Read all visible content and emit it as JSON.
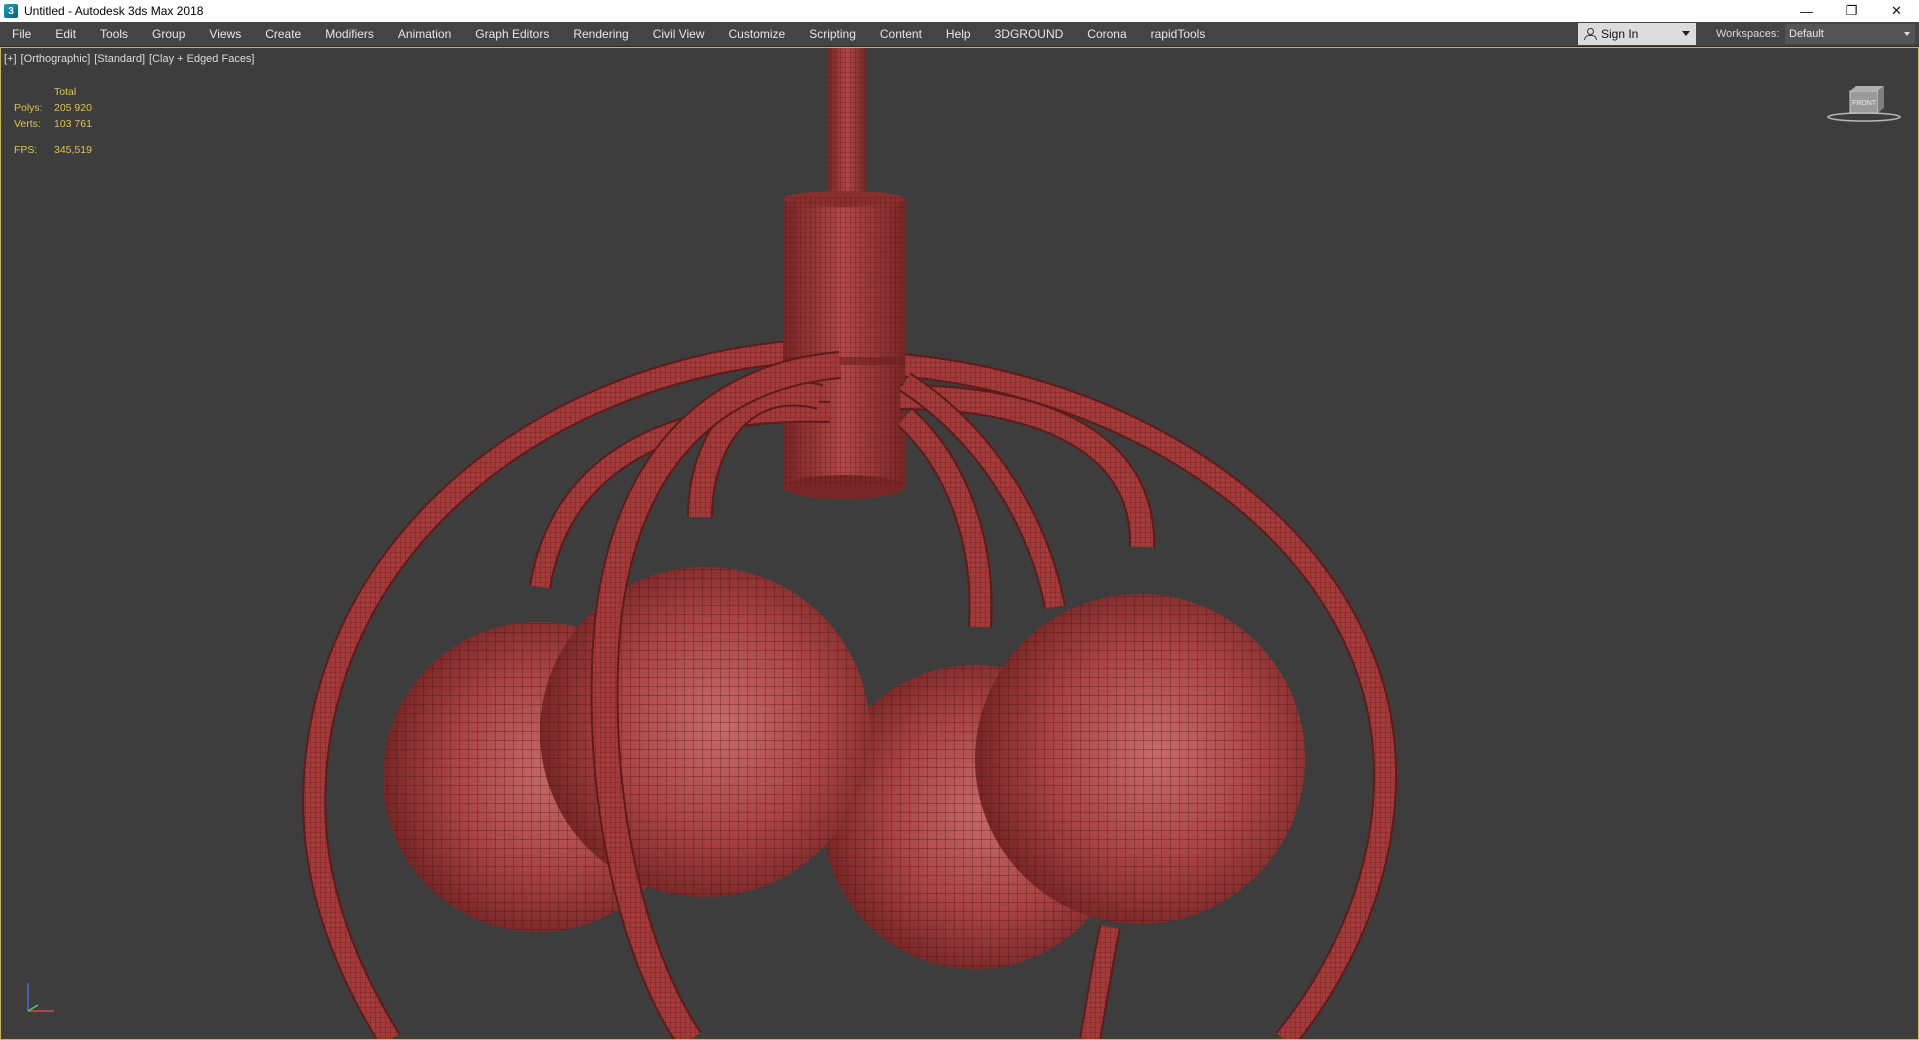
{
  "window": {
    "title": "Untitled - Autodesk 3ds Max 2018",
    "controls": [
      "minimize",
      "restore",
      "close"
    ]
  },
  "menubar": {
    "items": [
      "File",
      "Edit",
      "Tools",
      "Group",
      "Views",
      "Create",
      "Modifiers",
      "Animation",
      "Graph Editors",
      "Rendering",
      "Civil View",
      "Customize",
      "Scripting",
      "Content",
      "Help",
      "3DGROUND",
      "Corona",
      "rapidTools"
    ],
    "sign_in": "Sign In",
    "workspaces_label": "Workspaces:",
    "workspace_value": "Default"
  },
  "viewport": {
    "labels": [
      "[+]",
      "[Orthographic]",
      "[Standard]",
      "[Clay + Edged Faces]"
    ],
    "stats": {
      "header": "Total",
      "polys_label": "Polys:",
      "polys_value": "205 920",
      "verts_label": "Verts:",
      "verts_value": "103 761",
      "fps_label": "FPS:",
      "fps_value": "345,519"
    },
    "viewcube_label": "FRONT",
    "mesh_color": "#a43a3a",
    "wire_color": "#3b1010",
    "background_color": "#3d3d3d",
    "stats_color": "#e0c341"
  }
}
